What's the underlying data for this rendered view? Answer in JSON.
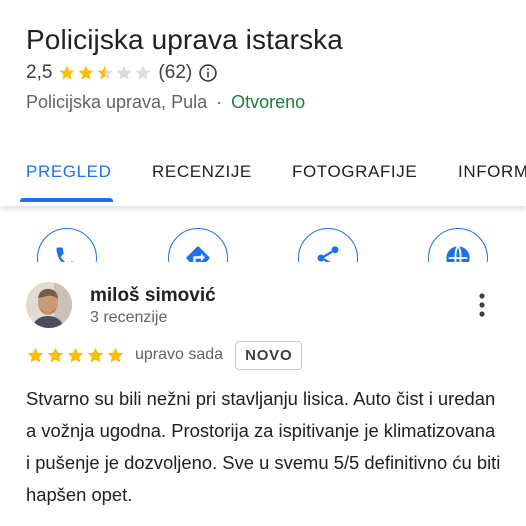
{
  "place": {
    "title": "Policijska uprava istarska",
    "rating": "2,5",
    "rating_value": 2.5,
    "review_count": "(62)",
    "category_location": "Policijska uprava, Pula",
    "separator": "·",
    "status": "Otvoreno"
  },
  "tabs": [
    {
      "label": "PREGLED",
      "active": true
    },
    {
      "label": "RECENZIJE",
      "active": false
    },
    {
      "label": "FOTOGRAFIJE",
      "active": false
    },
    {
      "label": "INFORM",
      "active": false
    }
  ],
  "actions": [
    {
      "icon": "phone-icon"
    },
    {
      "icon": "directions-icon"
    },
    {
      "icon": "share-icon"
    },
    {
      "icon": "website-icon"
    }
  ],
  "review": {
    "author": "miloš simović",
    "author_reviews": "3 recenzije",
    "stars": 5,
    "time": "upravo sada",
    "badge": "NOVO",
    "text": "Stvarno su bili nežni pri stavljanju lisica. Auto čist i uredan a vožnja ugodna. Prostorija za ispitivanje je klimatizovana i pušenje je dozvoljeno. Sve u svemu 5/5 definitivno ću biti hapšen opet."
  },
  "colors": {
    "accent": "#1a73e8",
    "star": "#fbbc04",
    "open": "#188038"
  }
}
